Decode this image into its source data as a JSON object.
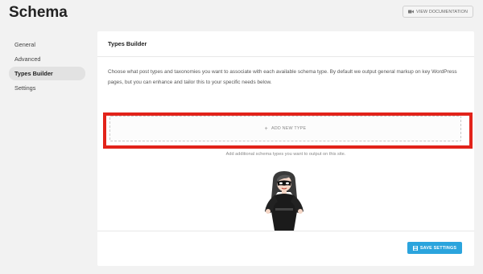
{
  "header": {
    "title": "Schema",
    "doc_button_label": "VIEW DOCUMENTATION",
    "doc_button_icon": "video-icon"
  },
  "sidebar": {
    "items": [
      {
        "label": "General",
        "active": false
      },
      {
        "label": "Advanced",
        "active": false
      },
      {
        "label": "Types Builder",
        "active": true
      },
      {
        "label": "Settings",
        "active": false
      }
    ]
  },
  "card": {
    "title": "Types Builder",
    "description": "Choose what post types and taxonomies you want to associate with each available schema type. By default we output general markup on key WordPress pages, but you can enhance and tailor this to your specific needs below.",
    "add_button_label": "ADD NEW TYPE",
    "add_button_icon": "plus-icon",
    "helper_text": "Add additional schema types you want to output on this site.",
    "save_button_label": "SAVE SETTINGS",
    "save_button_icon": "save-icon"
  },
  "colors": {
    "accent": "#2ba4dd",
    "highlight": "#e2231a",
    "background": "#f2f2f2"
  }
}
